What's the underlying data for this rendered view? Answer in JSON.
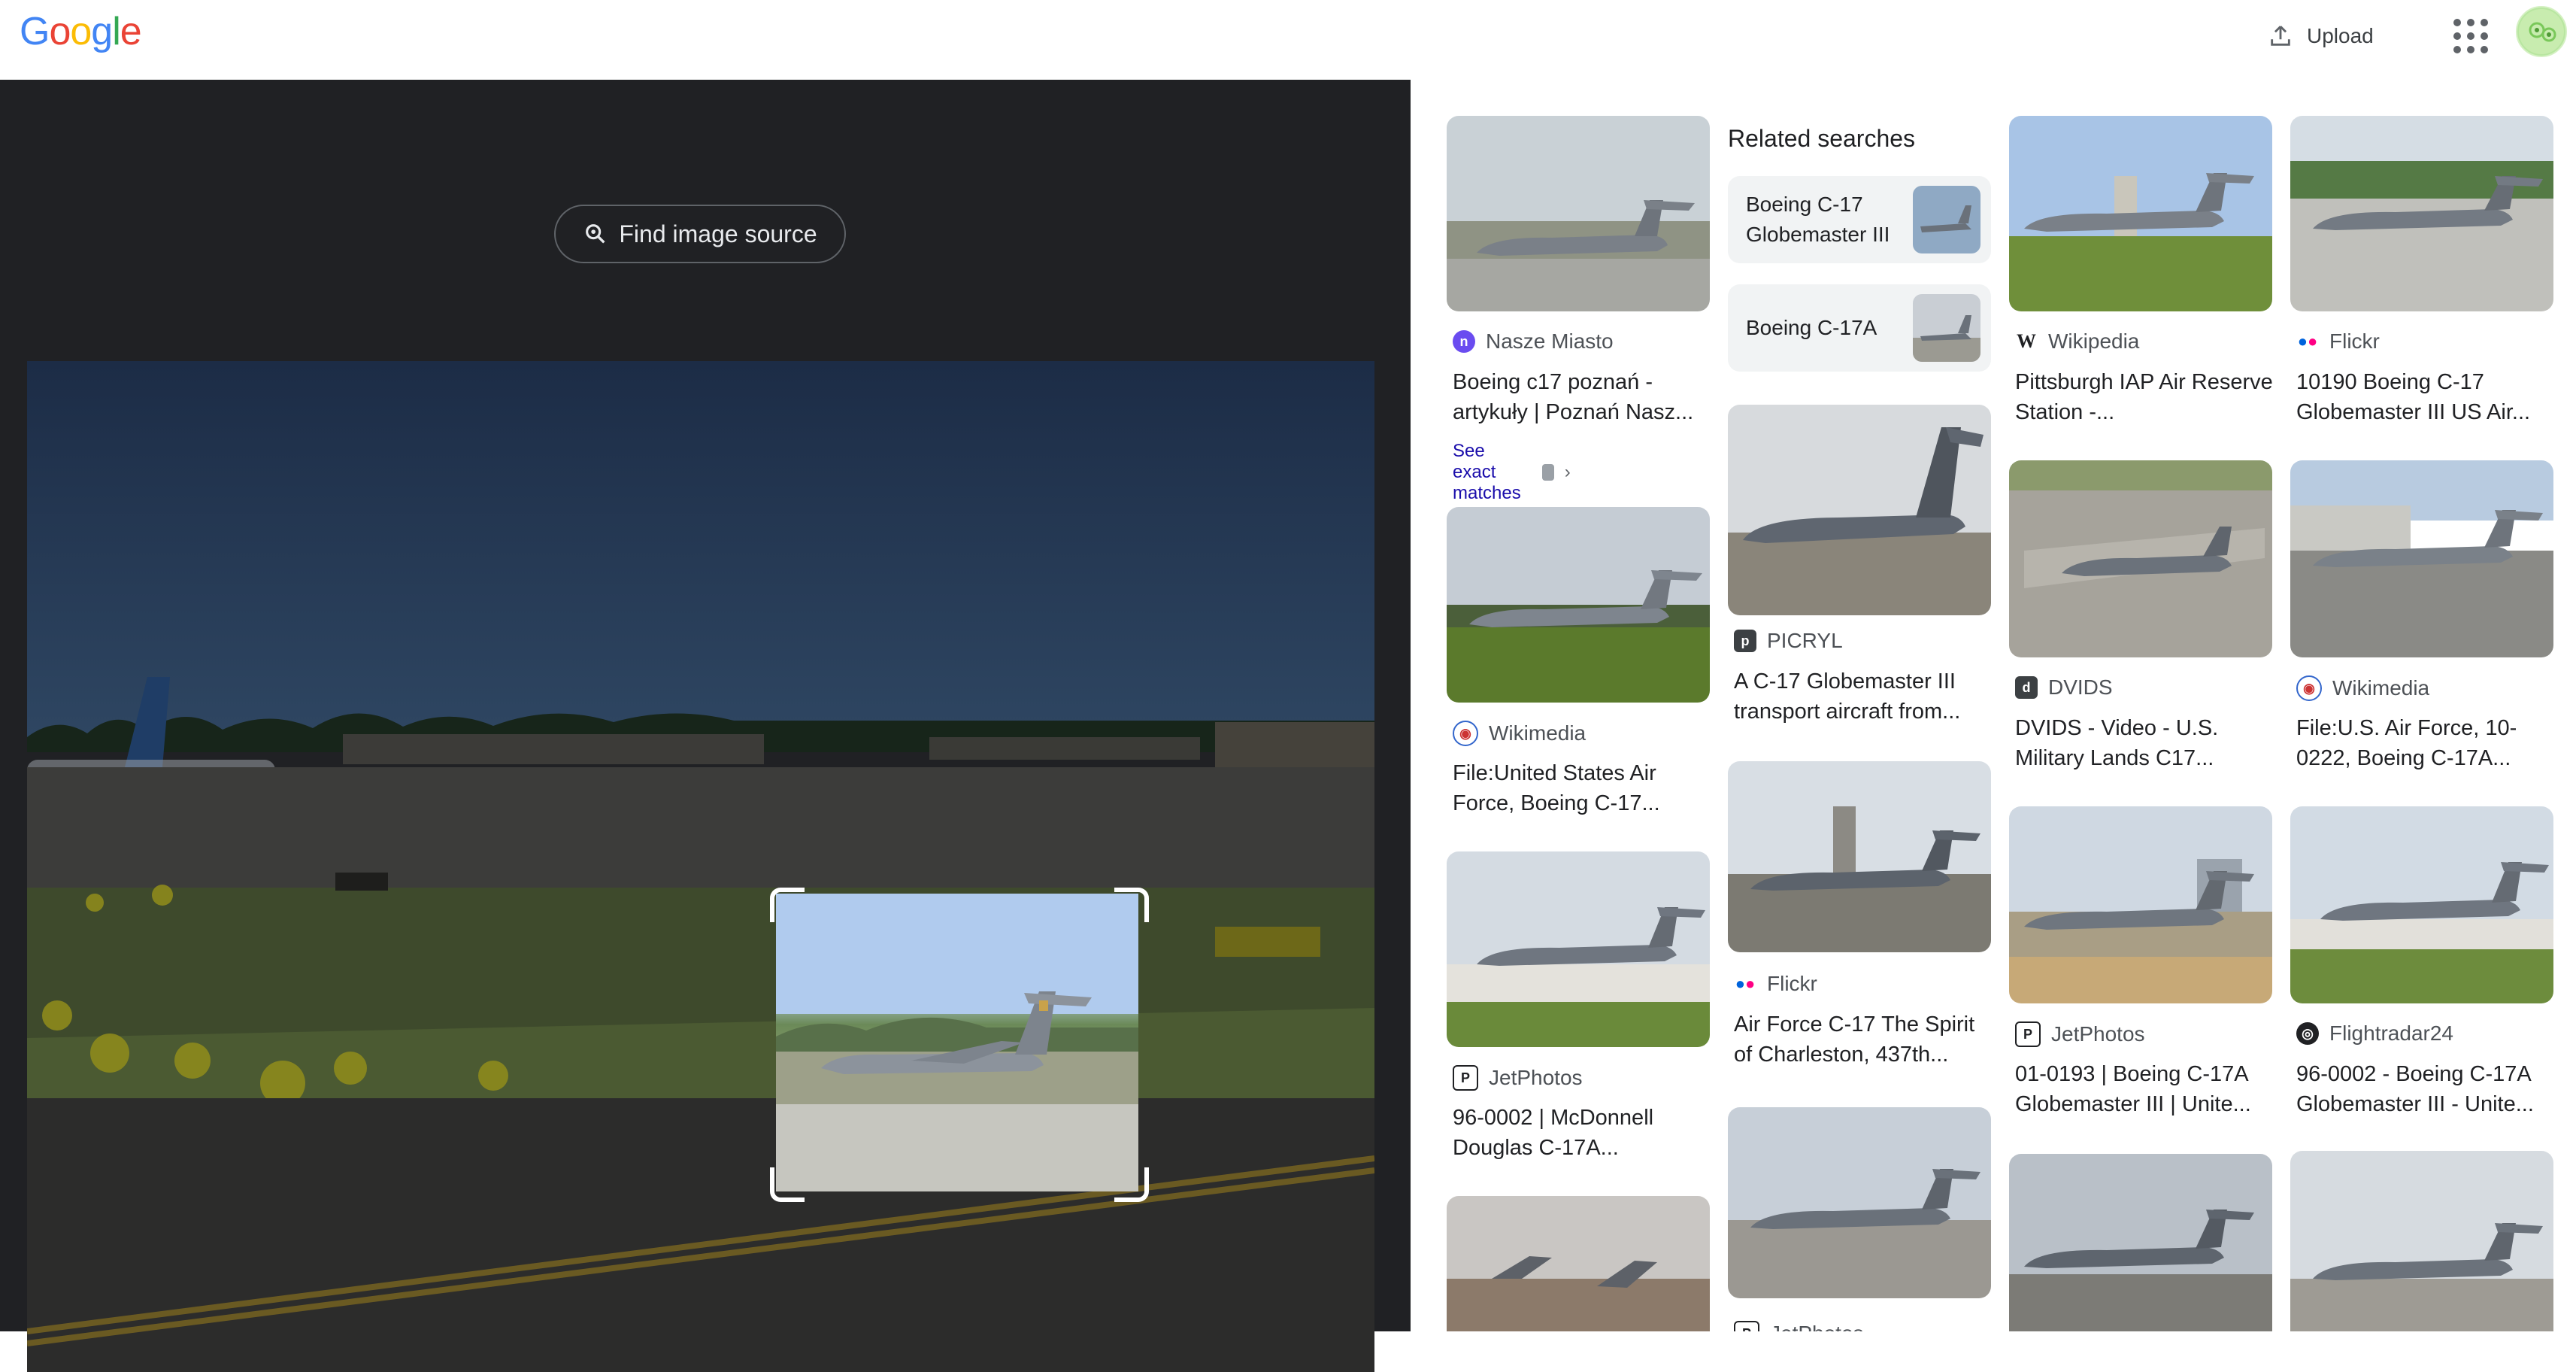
{
  "header": {
    "logo": [
      "G",
      "o",
      "o",
      "g",
      "l",
      "e"
    ],
    "logo_colors": [
      "#4285F4",
      "#EA4335",
      "#FBBC05",
      "#4285F4",
      "#34A853",
      "#EA4335"
    ],
    "upload_label": "Upload",
    "upload_icon": "upload-icon",
    "apps_icon": "apps-grid-icon"
  },
  "left_panel": {
    "find_source_label": "Find image source",
    "find_source_icon": "lens-search-icon"
  },
  "related": {
    "heading": "Related searches",
    "items": [
      {
        "label": "Boeing C-17 Globemaster III"
      },
      {
        "label": "Boeing C-17A"
      }
    ]
  },
  "results": {
    "col1": [
      {
        "source": "Nasze Miasto",
        "icon": "nasze-miasto-icon",
        "icon_color": "#6a4cf0",
        "title": "Boeing c17 poznań - artykuły | Poznań Nasz..."
      },
      {
        "source": "Wikimedia",
        "icon": "wikimedia-icon",
        "icon_color": "#3366cc",
        "title": "File:United States Air Force, Boeing C-17..."
      },
      {
        "source": "JetPhotos",
        "icon": "jetphotos-icon",
        "icon_color": "#202124",
        "title": "96-0002 | McDonnell Douglas C-17A..."
      }
    ],
    "see_exact_label": "See exact matches",
    "col2": [
      {
        "source": "PICRYL",
        "icon": "picryl-icon",
        "icon_color": "#3c4043",
        "title": "A C-17 Globemaster III transport aircraft from..."
      },
      {
        "source": "Flickr",
        "icon": "flickr-icon",
        "icon_color": "#0063dc",
        "title": "Air Force C-17 The Spirit of Charleston, 437th..."
      },
      {
        "source": "JetPhotos",
        "icon": "jetphotos-icon",
        "icon_color": "#202124",
        "title": ""
      }
    ],
    "col3": [
      {
        "source": "Wikipedia",
        "icon": "wikipedia-icon",
        "icon_color": "#202124",
        "title": "Pittsburgh IAP Air Reserve Station -..."
      },
      {
        "source": "DVIDS",
        "icon": "dvids-icon",
        "icon_color": "#3c4043",
        "title": "DVIDS - Video - U.S. Military Lands C17..."
      },
      {
        "source": "JetPhotos",
        "icon": "jetphotos-icon",
        "icon_color": "#202124",
        "title": "01-0193 | Boeing C-17A Globemaster III | Unite..."
      }
    ],
    "col4": [
      {
        "source": "Flickr",
        "icon": "flickr-icon",
        "icon_color": "#0063dc",
        "title": "10190 Boeing C-17 Globemaster III US Air..."
      },
      {
        "source": "Wikimedia",
        "icon": "wikimedia-icon",
        "icon_color": "#3366cc",
        "title": "File:U.S. Air Force, 10-0222, Boeing C-17A..."
      },
      {
        "source": "Flightradar24",
        "icon": "flightradar24-icon",
        "icon_color": "#202124",
        "title": "96-0002 - Boeing C-17A Globemaster III - Unite..."
      }
    ]
  }
}
